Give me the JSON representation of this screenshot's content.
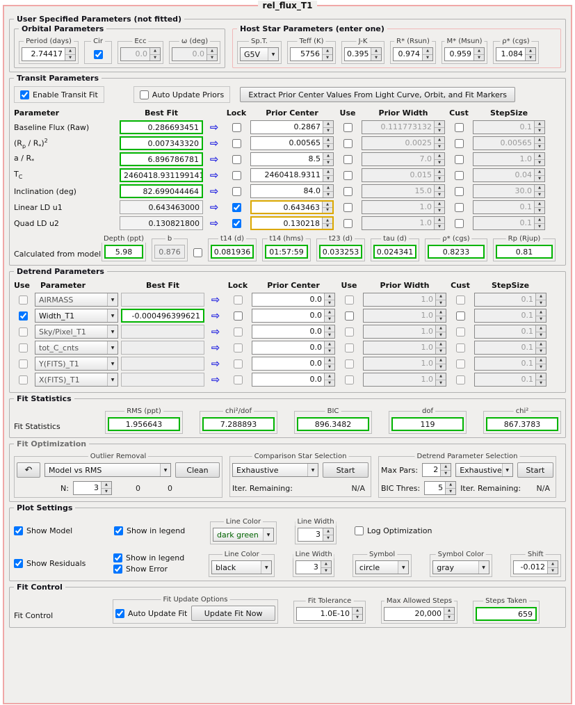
{
  "window_title": "rel_flux_T1",
  "icons": {
    "transfer": "⇨",
    "undo": "↶",
    "spinner_up": "▲",
    "spinner_down": "▼",
    "combo_arrow": "▼"
  },
  "colors": {
    "fit_value_green": "#00b400",
    "locked_prior_yellow": "#dba800",
    "transfer_arrow_blue": "#2323e0",
    "host_star_border_pink": "#f0b8b8",
    "dark_green_text": "#006400",
    "panel_border_pink": "#f0a7a7"
  },
  "user_params": {
    "title": "User Specified Parameters (not fitted)",
    "orbital": {
      "title": "Orbital Parameters",
      "period_label": "Period (days)",
      "period": "2.74417",
      "cir_label": "Cir",
      "cir_checked": true,
      "ecc_label": "Ecc",
      "ecc": "0.0",
      "omega_label": "ω (deg)",
      "omega": "0.0"
    },
    "host_star": {
      "title": "Host Star Parameters (enter one)",
      "spt_label": "Sp.T.",
      "spt": "G5V",
      "teff_label": "Teff (K)",
      "teff": "5756",
      "jk_label": "J-K",
      "jk": "0.395",
      "rstar_label": "R* (Rsun)",
      "rstar": "0.974",
      "mstar_label": "M* (Msun)",
      "mstar": "0.959",
      "rho_label": "ρ* (cgs)",
      "rho": "1.084"
    }
  },
  "transit": {
    "title": "Transit Parameters",
    "enable_label": "Enable Transit Fit",
    "enable_checked": true,
    "auto_update_label": "Auto Update Priors",
    "auto_update_checked": false,
    "extract_button": "Extract Prior Center Values From Light Curve, Orbit, and Fit Markers",
    "headers": {
      "parameter": "Parameter",
      "best_fit": "Best Fit",
      "lock": "Lock",
      "prior_center": "Prior Center",
      "use": "Use",
      "prior_width": "Prior Width",
      "cust": "Cust",
      "step_size": "StepSize"
    },
    "rows": [
      {
        "param_html": "Baseline Flux (Raw)",
        "best_fit": "0.286693451",
        "best_style": "green",
        "lock": false,
        "prior_center": "0.2867",
        "pc_style": "plain",
        "use": false,
        "prior_width": "0.111773132",
        "cust": false,
        "step_size": "0.1"
      },
      {
        "param_html": "(R<sub>p</sub> / R<sub>*</sub>)<sup>2</sup>",
        "best_fit": "0.007343320",
        "best_style": "green",
        "lock": false,
        "prior_center": "0.00565",
        "pc_style": "plain",
        "use": false,
        "prior_width": "0.0025",
        "cust": false,
        "step_size": "0.00565"
      },
      {
        "param_html": "a / R<sub>*</sub>",
        "best_fit": "6.896786781",
        "best_style": "green",
        "lock": false,
        "prior_center": "8.5",
        "pc_style": "plain",
        "use": false,
        "prior_width": "7.0",
        "cust": false,
        "step_size": "1.0"
      },
      {
        "param_html": "T<sub>C</sub>",
        "best_fit": "2460418.931199141",
        "best_style": "green",
        "lock": false,
        "prior_center": "2460418.9311",
        "pc_style": "plain",
        "use": false,
        "prior_width": "0.015",
        "cust": false,
        "step_size": "0.04"
      },
      {
        "param_html": "Inclination (deg)",
        "best_fit": "82.699044464",
        "best_style": "green",
        "lock": false,
        "prior_center": "84.0",
        "pc_style": "plain",
        "use": false,
        "prior_width": "15.0",
        "cust": false,
        "step_size": "30.0"
      },
      {
        "param_html": "Linear LD u1",
        "best_fit": "0.643463000",
        "best_style": "plain",
        "lock": true,
        "prior_center": "0.643463",
        "pc_style": "locked",
        "use": false,
        "prior_width": "1.0",
        "cust": false,
        "step_size": "0.1"
      },
      {
        "param_html": "Quad LD u2",
        "best_fit": "0.130821800",
        "best_style": "plain",
        "lock": true,
        "prior_center": "0.130218",
        "pc_style": "locked",
        "use": false,
        "prior_width": "1.0",
        "cust": false,
        "step_size": "0.1"
      }
    ],
    "calculated": {
      "label": "Calculated from model",
      "depth_label": "Depth (ppt)",
      "depth": "5.98",
      "b_label": "b",
      "b": "0.876",
      "b_checked": false,
      "t14d_label": "t14 (d)",
      "t14d": "0.081936",
      "t14hms_label": "t14 (hms)",
      "t14hms": "01:57:59",
      "t23_label": "t23 (d)",
      "t23": "0.033253",
      "tau_label": "tau (d)",
      "tau": "0.024341",
      "rho_label": "ρ* (cgs)",
      "rho": "0.8233",
      "rp_label": "Rp (Rjup)",
      "rp": "0.81"
    }
  },
  "detrend": {
    "title": "Detrend Parameters",
    "headers": {
      "use": "Use",
      "parameter": "Parameter",
      "best_fit": "Best Fit",
      "lock": "Lock",
      "prior_center": "Prior Center",
      "use2": "Use",
      "prior_width": "Prior Width",
      "cust": "Cust",
      "step_size": "StepSize"
    },
    "rows": [
      {
        "use": false,
        "param": "AIRMASS",
        "best_fit": "",
        "best_style": "empty",
        "lock": false,
        "prior_center": "0.0",
        "use2": false,
        "prior_width": "1.0",
        "cust": false,
        "step_size": "0.1",
        "enabled": false
      },
      {
        "use": true,
        "param": "Width_T1",
        "best_fit": "-0.000496399621",
        "best_style": "green",
        "lock": false,
        "prior_center": "0.0",
        "use2": false,
        "prior_width": "1.0",
        "cust": false,
        "step_size": "0.1",
        "enabled": true
      },
      {
        "use": false,
        "param": "Sky/Pixel_T1",
        "best_fit": "",
        "best_style": "empty",
        "lock": false,
        "prior_center": "0.0",
        "use2": false,
        "prior_width": "1.0",
        "cust": false,
        "step_size": "0.1",
        "enabled": false
      },
      {
        "use": false,
        "param": "tot_C_cnts",
        "best_fit": "",
        "best_style": "empty",
        "lock": false,
        "prior_center": "0.0",
        "use2": false,
        "prior_width": "1.0",
        "cust": false,
        "step_size": "0.1",
        "enabled": false
      },
      {
        "use": false,
        "param": "Y(FITS)_T1",
        "best_fit": "",
        "best_style": "empty",
        "lock": false,
        "prior_center": "0.0",
        "use2": false,
        "prior_width": "1.0",
        "cust": false,
        "step_size": "0.1",
        "enabled": false
      },
      {
        "use": false,
        "param": "X(FITS)_T1",
        "best_fit": "",
        "best_style": "empty",
        "lock": false,
        "prior_center": "0.0",
        "use2": false,
        "prior_width": "1.0",
        "cust": false,
        "step_size": "0.1",
        "enabled": false
      }
    ]
  },
  "stats": {
    "title": "Fit Statistics",
    "label": "Fit Statistics",
    "items": [
      {
        "label": "RMS (ppt)",
        "value": "1.956643"
      },
      {
        "label": "chi²/dof",
        "value": "7.288893"
      },
      {
        "label": "BIC",
        "value": "896.3482"
      },
      {
        "label": "dof",
        "value": "119"
      },
      {
        "label": "chi²",
        "value": "867.3783"
      }
    ]
  },
  "optimization": {
    "title": "Fit Optimization",
    "outlier": {
      "title": "Outlier Removal",
      "method": "Model vs RMS",
      "clean_button": "Clean",
      "n_label": "N:",
      "n": "3",
      "removed1": "0",
      "removed2": "0"
    },
    "comparison": {
      "title": "Comparison Star Selection",
      "method": "Exhaustive",
      "start_button": "Start",
      "iter_label": "Iter. Remaining:",
      "iter": "N/A"
    },
    "detrend_sel": {
      "title": "Detrend Parameter Selection",
      "max_label": "Max Pars:",
      "max_pars": "2",
      "method": "Exhaustive",
      "start_button": "Start",
      "bic_label": "BIC Thres:",
      "bic_thres": "5",
      "iter_label": "Iter. Remaining:",
      "iter": "N/A"
    }
  },
  "plot": {
    "title": "Plot Settings",
    "model": {
      "label": "Show Model",
      "checked": true,
      "legend_label": "Show in legend",
      "legend_checked": true,
      "color_label": "Line Color",
      "color": "dark green",
      "width_label": "Line Width",
      "width": "3",
      "log_label": "Log Optimization",
      "log_checked": false
    },
    "residuals": {
      "label": "Show Residuals",
      "checked": true,
      "legend_label": "Show in legend",
      "legend_checked": true,
      "error_label": "Show Error",
      "error_checked": true,
      "color_label": "Line Color",
      "color": "black",
      "width_label": "Line Width",
      "width": "3",
      "symbol_label": "Symbol",
      "symbol": "circle",
      "symbol_color_label": "Symbol Color",
      "symbol_color": "gray",
      "shift_label": "Shift",
      "shift": "-0.012"
    }
  },
  "control": {
    "title": "Fit Control",
    "label": "Fit Control",
    "update_options_title": "Fit Update Options",
    "auto_update_label": "Auto Update Fit",
    "auto_update_checked": true,
    "update_now_button": "Update Fit Now",
    "tolerance_label": "Fit Tolerance",
    "tolerance": "1.0E-10",
    "max_steps_label": "Max Allowed Steps",
    "max_steps": "20,000",
    "steps_taken_label": "Steps Taken",
    "steps_taken": "659"
  }
}
